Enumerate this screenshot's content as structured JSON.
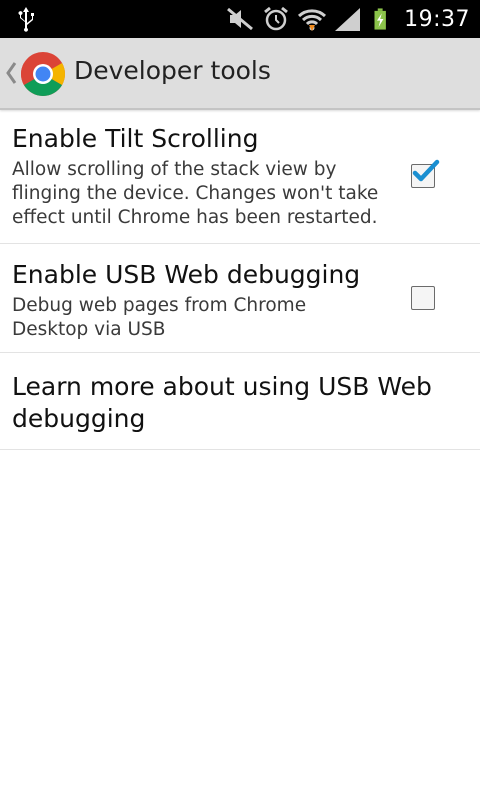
{
  "status_bar": {
    "time": "19:37",
    "icons": [
      "usb-icon",
      "mute-icon",
      "alarm-icon",
      "wifi-icon",
      "signal-icon",
      "battery-charging-icon"
    ]
  },
  "action_bar": {
    "title": "Developer tools",
    "icons": [
      "up-chevron-icon",
      "chrome-logo"
    ]
  },
  "preferences": [
    {
      "title": "Enable Tilt Scrolling",
      "summary": "Allow scrolling of the stack view by flinging the device. Changes won't take effect until Chrome has been restarted.",
      "checked": true
    },
    {
      "title": "Enable USB Web debugging",
      "summary": "Debug web pages from Chrome Desktop via USB",
      "checked": false
    },
    {
      "title": "Learn more about using USB Web debugging"
    }
  ],
  "colors": {
    "status_bar_bg": "#000000",
    "action_bar_bg": "#dedede",
    "check_accent": "#1a8fd1",
    "battery_accent": "#8bc34a"
  }
}
